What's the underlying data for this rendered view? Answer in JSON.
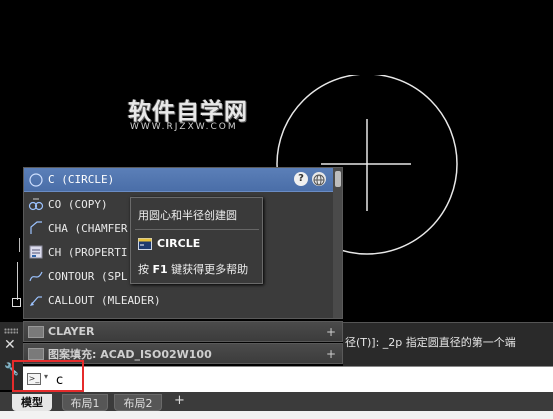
{
  "watermark": {
    "brand": "软件自学网",
    "url": "WWW.RJZXW.COM"
  },
  "autocomplete": {
    "help_icon": "?",
    "items": [
      {
        "label": "C (CIRCLE)",
        "icon": "circle-icon",
        "selected": true
      },
      {
        "label": "CO (COPY)",
        "icon": "copy-icon",
        "selected": false
      },
      {
        "label": "CHA (CHAMFER",
        "icon": "chamfer-icon",
        "selected": false
      },
      {
        "label": "CH (PROPERTI",
        "icon": "properties-icon",
        "selected": false
      },
      {
        "label": "CONTOUR (SPL",
        "icon": "contour-icon",
        "selected": false
      },
      {
        "label": "CALLOUT (MLEADER)",
        "icon": "callout-icon",
        "selected": false
      }
    ]
  },
  "tooltip": {
    "description": "用圆心和半径创建圆",
    "command": "CIRCLE",
    "help_prefix": "按 ",
    "help_key": "F1",
    "help_suffix": " 键获得更多帮助"
  },
  "palette": {
    "rows": [
      {
        "label": "CLAYER",
        "plus": "+"
      },
      {
        "label": "图案填充: ACAD_ISO02W100",
        "plus": "+"
      }
    ]
  },
  "command_line": {
    "history": "径(T)]: _2p 指定圆直径的第一个端",
    "prompt_arrow": "▾",
    "input_value": "c"
  },
  "tabs": [
    {
      "label": "模型",
      "active": true
    },
    {
      "label": "布局1",
      "active": false
    },
    {
      "label": "布局2",
      "active": false
    }
  ],
  "add_tab": "+",
  "colors": {
    "highlight_box": "#e52b2b",
    "selection": "#5b7fb8",
    "background": "#000000"
  }
}
